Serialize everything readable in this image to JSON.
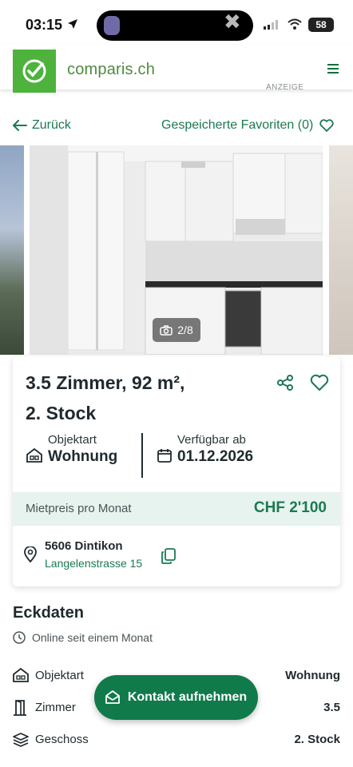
{
  "status_bar": {
    "time": "03:15",
    "battery": "58"
  },
  "header": {
    "brand": "comparis.ch",
    "ad_label": "ANZEIGE"
  },
  "nav": {
    "back": "Zurück",
    "favorites": "Gespeicherte Favoriten (0)"
  },
  "gallery": {
    "counter": "2/8"
  },
  "listing": {
    "title_line1": "3.5 Zimmer, 92 m²,",
    "title_line2": "2. Stock",
    "facts": [
      {
        "label": "Objektart",
        "value": "Wohnung"
      },
      {
        "label": "Verfügbar ab",
        "value": "01.12.2026"
      }
    ],
    "price_label": "Mietpreis pro Monat",
    "price_value": "CHF 2'100",
    "location": {
      "city": "5606 Dintikon",
      "street": "Langelenstrasse 15"
    }
  },
  "eckdaten": {
    "title": "Eckdaten",
    "online_since": "Online seit einem Monat",
    "rows": [
      {
        "label": "Objektart",
        "value": "Wohnung",
        "icon": "house-icon"
      },
      {
        "label": "Zimmer",
        "value": "3.5",
        "icon": "door-icon"
      },
      {
        "label": "Geschoss",
        "value": "2. Stock",
        "icon": "layers-icon"
      }
    ]
  },
  "cta": {
    "label": "Kontakt aufnehmen"
  },
  "colors": {
    "brand_green": "#4db33d",
    "accent": "#1a7a52",
    "cta": "#107a4a",
    "price_bg": "#e7f3ee"
  }
}
